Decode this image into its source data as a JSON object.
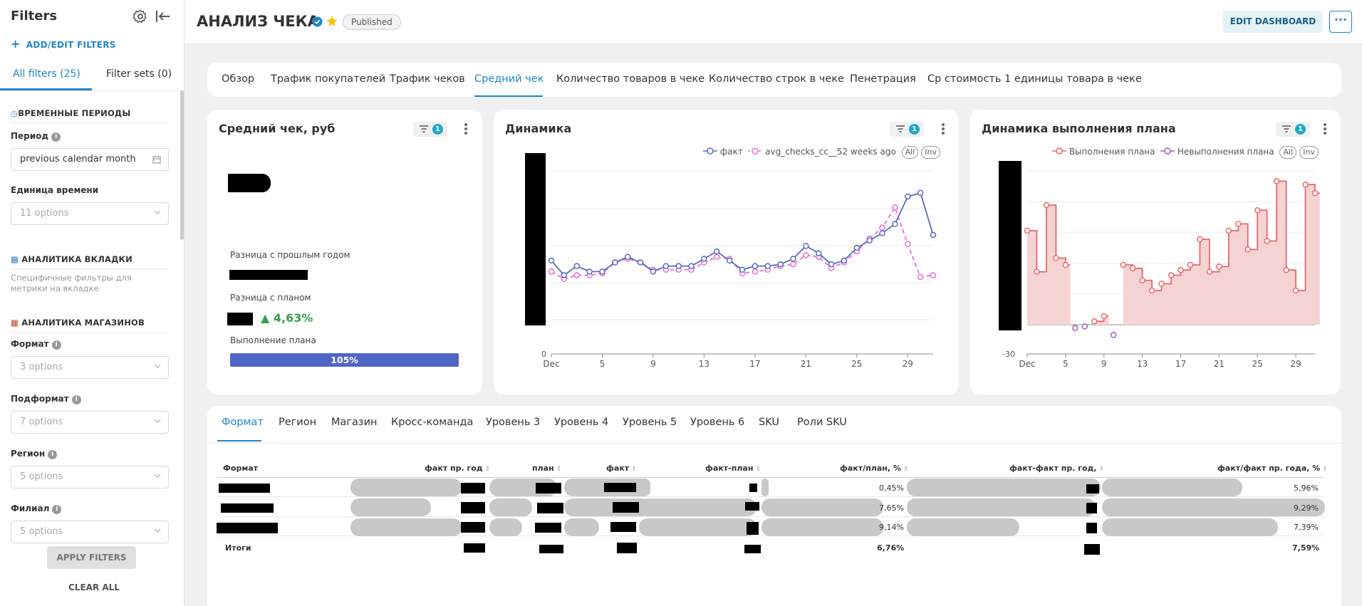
{
  "sidebar": {
    "title": "Filters",
    "add_filters": "ADD/EDIT FILTERS",
    "tabs": [
      "All filters (25)",
      "Filter sets (0)"
    ],
    "sections": [
      "ВРЕМЕННЫЕ ПЕРИОДЫ",
      "АНАЛИТИКА ВКЛАДКИ",
      "АНАЛИТИКА МАГАЗИНОВ"
    ],
    "section_hint": "Специфичные фильтры для метрики на вкладке",
    "filters": [
      {
        "label": "Период",
        "value": "previous calendar month"
      },
      {
        "label": "Единица времени",
        "value": "11 options"
      },
      {
        "label": "Формат",
        "value": "3 options"
      },
      {
        "label": "Подформат",
        "value": "7 options"
      },
      {
        "label": "Регион",
        "value": "5 options"
      },
      {
        "label": "Филиал",
        "value": "5 options"
      }
    ],
    "apply": "APPLY FILTERS",
    "clear": "CLEAR ALL"
  },
  "header": {
    "title": "АНАЛИЗ ЧЕКА",
    "status": "Published",
    "edit_button": "EDIT DASHBOARD"
  },
  "tabs": [
    "Обзор",
    "Трафик покупателей",
    "Трафик чеков",
    "Средний чек",
    "Количество товаров в чеке",
    "Количество строк в чеке",
    "Пенетрация",
    "Ср стоимость 1 единицы товара в чеке"
  ],
  "kpi": {
    "title": "Средний чек, руб",
    "filter_count": "1",
    "prev_year_label": "Разница с прошлым годом",
    "plan_label": "Разница с планом",
    "plan_delta": "▲ 4,63%",
    "completion_label": "Выполнение плана",
    "completion_value": "105%",
    "completion_fraction": 1.0
  },
  "chart_dyn": {
    "title": "Динамика",
    "filter_count": "1",
    "legend": [
      "факт",
      "avg_checks_cc__52 weeks ago"
    ],
    "pills": [
      "All",
      "Inv"
    ],
    "colors": {
      "fact": "#5b6bbf",
      "prev": "#e36fd6"
    }
  },
  "chart_plan": {
    "title": "Динамика выполнения плана",
    "filter_count": "1",
    "legend": [
      "Выполнения плана",
      "Невыполнения плана"
    ],
    "pills": [
      "All",
      "Inv"
    ],
    "colors": {
      "yes": "#e8676d",
      "no": "#9a5fc0",
      "fill": "#f6d3d3"
    }
  },
  "chart_data": [
    {
      "type": "line",
      "title": "Динамика",
      "x_ticks": [
        "Dec",
        "5",
        "9",
        "13",
        "17",
        "21",
        "25",
        "29"
      ],
      "y_ticks": [
        "0"
      ],
      "x": [
        1,
        2,
        3,
        4,
        5,
        6,
        7,
        8,
        9,
        10,
        11,
        12,
        13,
        14,
        15,
        16,
        17,
        18,
        19,
        20,
        21,
        22,
        23,
        24,
        25,
        26,
        27,
        28,
        29,
        30,
        31
      ],
      "series": [
        {
          "name": "факт",
          "values": [
            0.51,
            0.43,
            0.48,
            0.45,
            0.45,
            0.5,
            0.53,
            0.5,
            0.45,
            0.48,
            0.48,
            0.48,
            0.52,
            0.56,
            0.51,
            0.46,
            0.48,
            0.48,
            0.49,
            0.52,
            0.59,
            0.55,
            0.49,
            0.51,
            0.58,
            0.62,
            0.66,
            0.71,
            0.86,
            0.88,
            0.65
          ]
        },
        {
          "name": "avg_checks_cc__52 weeks ago",
          "values": [
            0.45,
            0.41,
            0.43,
            0.43,
            0.44,
            0.5,
            0.52,
            0.5,
            0.46,
            0.46,
            0.46,
            0.46,
            0.5,
            0.53,
            0.52,
            0.44,
            0.45,
            0.46,
            0.48,
            0.49,
            0.54,
            0.53,
            0.47,
            0.5,
            0.56,
            0.63,
            0.69,
            0.8,
            0.6,
            0.42,
            0.43
          ]
        }
      ]
    },
    {
      "type": "line",
      "title": "Динамика выполнения плана",
      "x_ticks": [
        "Dec",
        "5",
        "9",
        "13",
        "17",
        "21",
        "25",
        "29"
      ],
      "y_ticks": [
        "-30"
      ],
      "x": [
        1,
        2,
        3,
        4,
        5,
        6,
        7,
        8,
        9,
        10,
        11,
        12,
        13,
        14,
        15,
        16,
        17,
        18,
        19,
        20,
        21,
        22,
        23,
        24,
        25,
        26,
        27,
        28,
        29,
        30,
        31
      ],
      "series": [
        {
          "name": "Выполнения плана",
          "values": [
            55,
            31,
            70,
            39,
            35,
            null,
            null,
            2,
            5,
            null,
            35,
            33,
            26,
            20,
            24,
            29,
            32,
            35,
            50,
            31,
            34,
            55,
            59,
            44,
            67,
            49,
            84,
            32,
            20,
            82,
            77
          ]
        },
        {
          "name": "Невыполнения плана",
          "values": [
            null,
            null,
            null,
            null,
            null,
            -2,
            -1,
            null,
            null,
            -6,
            null,
            null,
            null,
            null,
            null,
            null,
            null,
            null,
            null,
            null,
            null,
            null,
            null,
            null,
            null,
            null,
            null,
            null,
            null,
            null,
            null
          ]
        }
      ]
    }
  ],
  "bottom": {
    "tabs": [
      "Формат",
      "Регион",
      "Магазин",
      "Кросс-команда",
      "Уровень 3",
      "Уровень 4",
      "Уровень 5",
      "Уровень 6",
      "SKU",
      "Роли SKU"
    ],
    "columns": [
      "Формат",
      "факт пр. год",
      "план",
      "факт",
      "факт-план",
      "факт/план, %",
      "факт-факт пр. год,",
      "факт/факт пр. года, %"
    ],
    "rows": [
      {
        "pct_plan": "0,45%",
        "pct_year": "5,96%"
      },
      {
        "pct_plan": "7,65%",
        "pct_year": "9,29%"
      },
      {
        "pct_plan": "9,14%",
        "pct_year": "7,39%"
      }
    ],
    "total": {
      "label": "Итоги",
      "pct_plan": "6,76%",
      "pct_year": "7,59%"
    }
  }
}
